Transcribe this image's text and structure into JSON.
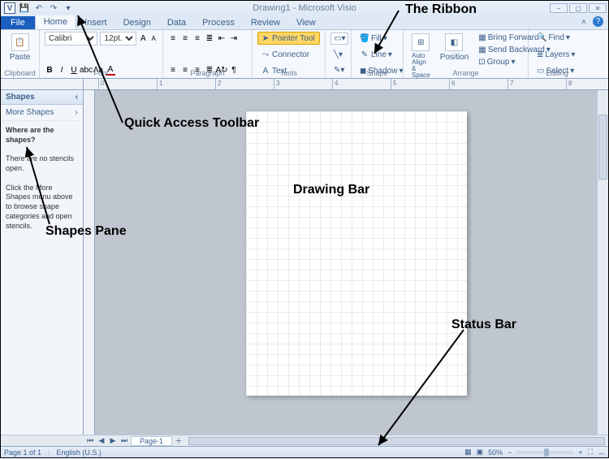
{
  "titlebar": {
    "title": "Drawing1 - Microsoft Visio",
    "qat": {
      "app_icon": "V",
      "save": "💾",
      "undo": "↶",
      "redo": "↷",
      "more": "▾"
    }
  },
  "tabs": [
    "File",
    "Home",
    "Insert",
    "Design",
    "Data",
    "Process",
    "Review",
    "View"
  ],
  "active_tab": "Home",
  "ribbon": {
    "clipboard": {
      "paste": "Paste",
      "label": "Clipboard"
    },
    "font": {
      "name": "Calibri",
      "size": "12pt.",
      "label": "Font"
    },
    "paragraph": {
      "label": "Paragraph"
    },
    "tools": {
      "pointer": "Pointer Tool",
      "connector": "Connector",
      "text": "Text",
      "label": "Tools"
    },
    "shape": {
      "fill": "Fill",
      "line": "Line",
      "shadow": "Shadow",
      "label": "Shape"
    },
    "arrange": {
      "autoalign": "Auto Align & Space",
      "position": "Position",
      "bringfwd": "Bring Forward",
      "sendback": "Send Backward",
      "group": "Group",
      "label": "Arrange"
    },
    "editing": {
      "find": "Find",
      "layers": "Layers",
      "select": "Select",
      "label": "Editing"
    }
  },
  "shapes_pane": {
    "header": "Shapes",
    "more": "More Shapes",
    "q": "Where are the shapes?",
    "l1": "There are no stencils open.",
    "l2": "Click the More Shapes menu above to browse shape categories and open stencils."
  },
  "page_tabs": {
    "page1": "Page-1"
  },
  "status": {
    "page": "Page 1 of 1",
    "lang": "English (U.S.)",
    "zoom": "50%"
  },
  "annotations": {
    "ribbon": "The Ribbon",
    "qat": "Quick Access Toolbar",
    "shapes": "Shapes Pane",
    "drawing": "Drawing Bar",
    "status": "Status Bar"
  },
  "ruler_ticks": [
    0,
    1,
    2,
    3,
    4,
    5,
    6,
    7,
    8
  ]
}
